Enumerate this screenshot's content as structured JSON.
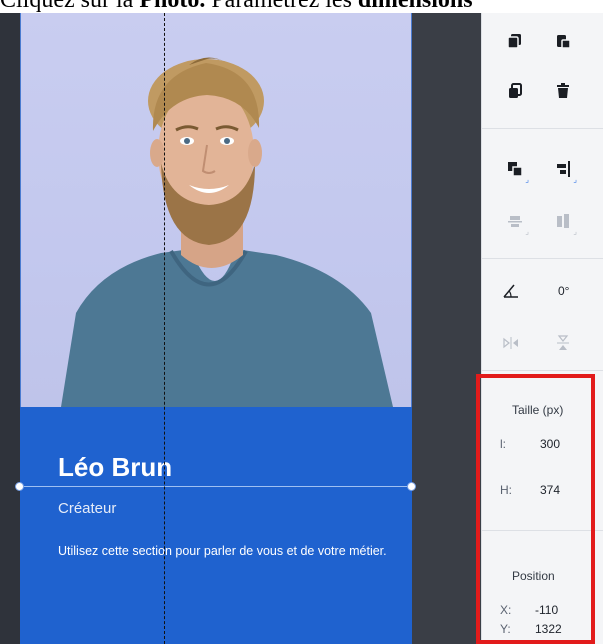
{
  "caption": {
    "part1": "Cliquez sur la ",
    "bold1": "Photo.",
    "part2": " Paramétrez les ",
    "bold2": "dimensions"
  },
  "card": {
    "name": "Léo Brun",
    "role": "Créateur",
    "description": "Utilisez cette section pour parler de vous et de votre métier."
  },
  "panel": {
    "rotation_value": "0°",
    "size_label": "Taille (px)",
    "width_label": "l:",
    "width_value": "300",
    "height_label": "H:",
    "height_value": "374",
    "position_label": "Position",
    "x_label": "X:",
    "x_value": "-110",
    "y_label": "Y:",
    "y_value": "1322"
  },
  "icons": {
    "copy": "copy-icon",
    "paste": "paste-icon",
    "duplicate": "duplicate-icon",
    "delete": "trash-icon",
    "arrange": "arrange-icon",
    "align": "align-icon",
    "distribute": "distribute-icon",
    "match_size": "match-size-icon",
    "rotate": "rotate-angle-icon",
    "flip_h": "flip-horizontal-icon",
    "flip_v": "flip-vertical-icon"
  },
  "colors": {
    "card_blue": "#1f62cf",
    "highlight_red": "#e21b1b",
    "photo_bg": "#c6cbef"
  }
}
